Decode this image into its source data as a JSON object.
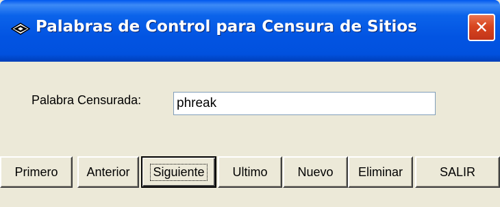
{
  "window": {
    "title": "Palabras de Control para Censura de Sitios",
    "close_glyph": "✕"
  },
  "form": {
    "label": "Palabra Censurada:",
    "value": "phreak"
  },
  "buttons": {
    "primero": "Primero",
    "anterior": "Anterior",
    "siguiente": "Siguiente",
    "ultimo": "Ultimo",
    "nuevo": "Nuevo",
    "eliminar": "Eliminar",
    "salir": "SALIR"
  },
  "colors": {
    "title_blue": "#0254e2",
    "close_red": "#d8461f",
    "face": "#ece9d8"
  }
}
